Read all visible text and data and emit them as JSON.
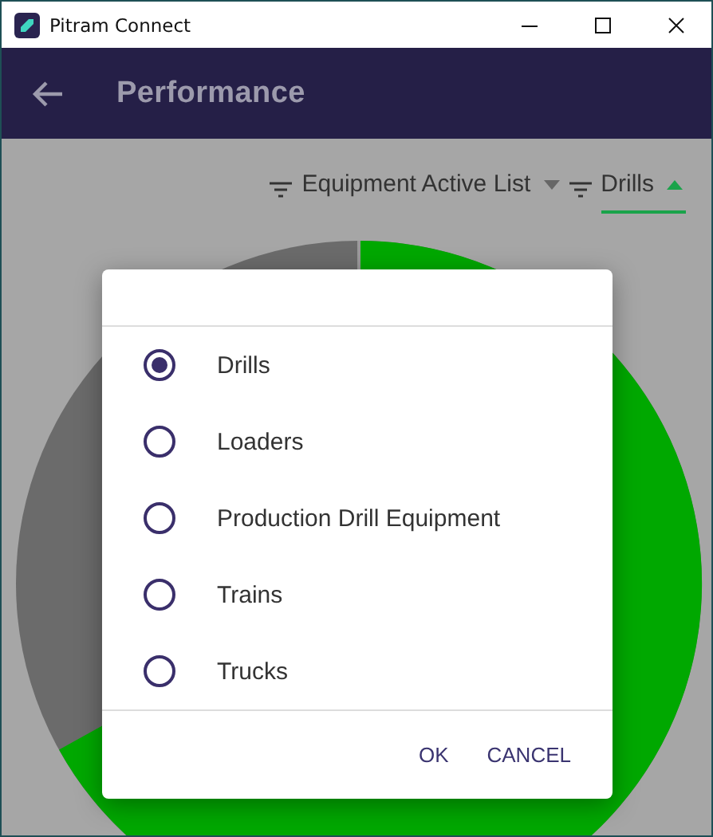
{
  "window": {
    "title": "Pitram Connect"
  },
  "app_bar": {
    "title": "Performance"
  },
  "filters": [
    {
      "label": "Equipment Active List",
      "expanded": false
    },
    {
      "label": "Drills",
      "expanded": true
    }
  ],
  "dialog": {
    "options": [
      {
        "label": "Drills",
        "selected": true
      },
      {
        "label": "Loaders",
        "selected": false
      },
      {
        "label": "Production Drill Equipment",
        "selected": false
      },
      {
        "label": "Trains",
        "selected": false
      },
      {
        "label": "Trucks",
        "selected": false
      }
    ],
    "buttons": [
      "OK",
      "CANCEL"
    ]
  }
}
